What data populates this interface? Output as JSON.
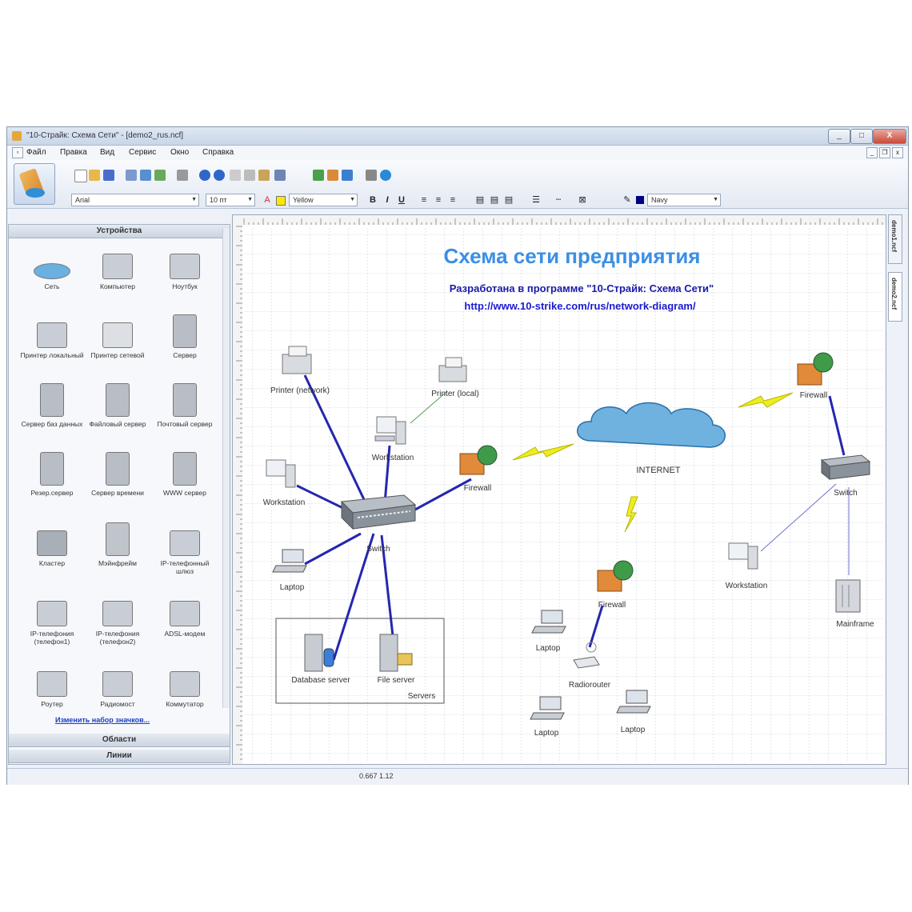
{
  "window": {
    "title": "\"10-Страйк: Схема Сети\" - [demo2_rus.ncf]",
    "buttons": [
      "_",
      "□",
      "X"
    ]
  },
  "menu": [
    "Файл",
    "Правка",
    "Вид",
    "Сервис",
    "Окно",
    "Справка"
  ],
  "toolbar": {
    "font": "Arial",
    "size": "10 пт",
    "fill_color": "Yellow",
    "line_color": "Navy",
    "bold": "B",
    "italic": "I",
    "underline": "U"
  },
  "left_panel": {
    "devices_header": "Устройства",
    "devices": [
      {
        "label": "Сеть",
        "icon": "cloud-icon"
      },
      {
        "label": "Компьютер",
        "icon": "computer-icon"
      },
      {
        "label": "Ноутбук",
        "icon": "laptop-icon"
      },
      {
        "label": "Принтер локальный",
        "icon": "printer-icon"
      },
      {
        "label": "Принтер сетевой",
        "icon": "network-printer-icon"
      },
      {
        "label": "Сервер",
        "icon": "server-icon"
      },
      {
        "label": "Сервер баз данных",
        "icon": "database-server-icon"
      },
      {
        "label": "Файловый сервер",
        "icon": "file-server-icon"
      },
      {
        "label": "Почтовый сервер",
        "icon": "mail-server-icon"
      },
      {
        "label": "Резер.сервер",
        "icon": "backup-server-icon"
      },
      {
        "label": "Сервер времени",
        "icon": "time-server-icon"
      },
      {
        "label": "WWW сервер",
        "icon": "www-server-icon"
      },
      {
        "label": "Кластер",
        "icon": "cluster-icon"
      },
      {
        "label": "Мэйнфрейм",
        "icon": "mainframe-icon"
      },
      {
        "label": "IP-телефонный шлюз",
        "icon": "ip-gateway-icon"
      },
      {
        "label": "IP-телефония (телефон1)",
        "icon": "ip-phone-icon"
      },
      {
        "label": "IP-телефония (телефон2)",
        "icon": "ip-phone2-icon"
      },
      {
        "label": "ADSL-модем",
        "icon": "adsl-modem-icon"
      },
      {
        "label": "Роутер",
        "icon": "router-icon"
      },
      {
        "label": "Радиомост",
        "icon": "radio-bridge-icon"
      },
      {
        "label": "Коммутатор",
        "icon": "switch-icon"
      }
    ],
    "change_link": "Изменить набор значков...",
    "areas_header": "Области",
    "lines_header": "Линии"
  },
  "diagram": {
    "title": "Схема сети предприятия",
    "subtitle": "Разработана в программе \"10-Страйк: Схема Сети\"",
    "url": "http://www.10-strike.com/rus/network-diagram/",
    "labels": {
      "printer_network": "Printer (network)",
      "printer_local": "Printer (local)",
      "workstation1": "Workstation",
      "workstation2": "Workstation",
      "workstation3": "Workstation",
      "switch1": "Switch",
      "switch2": "Switch",
      "firewall1": "Firewall",
      "firewall2": "Firewall",
      "firewall3": "Firewall",
      "internet": "INTERNET",
      "laptop1": "Laptop",
      "laptop2": "Laptop",
      "laptop3": "Laptop",
      "laptop4": "Laptop",
      "db_server": "Database server",
      "file_server": "File server",
      "servers_group": "Servers",
      "radiorouter": "Radiorouter",
      "mainframe": "Mainframe"
    },
    "colors": {
      "title": "#3a8fe6",
      "subtitle": "#1a1aa8",
      "link": "#1a1ad0",
      "cable": "#2626b0",
      "lightning": "#ecec20"
    }
  },
  "tabs": [
    "demo1.ncf",
    "demo2.ncf"
  ],
  "status": "0.667  1.12"
}
